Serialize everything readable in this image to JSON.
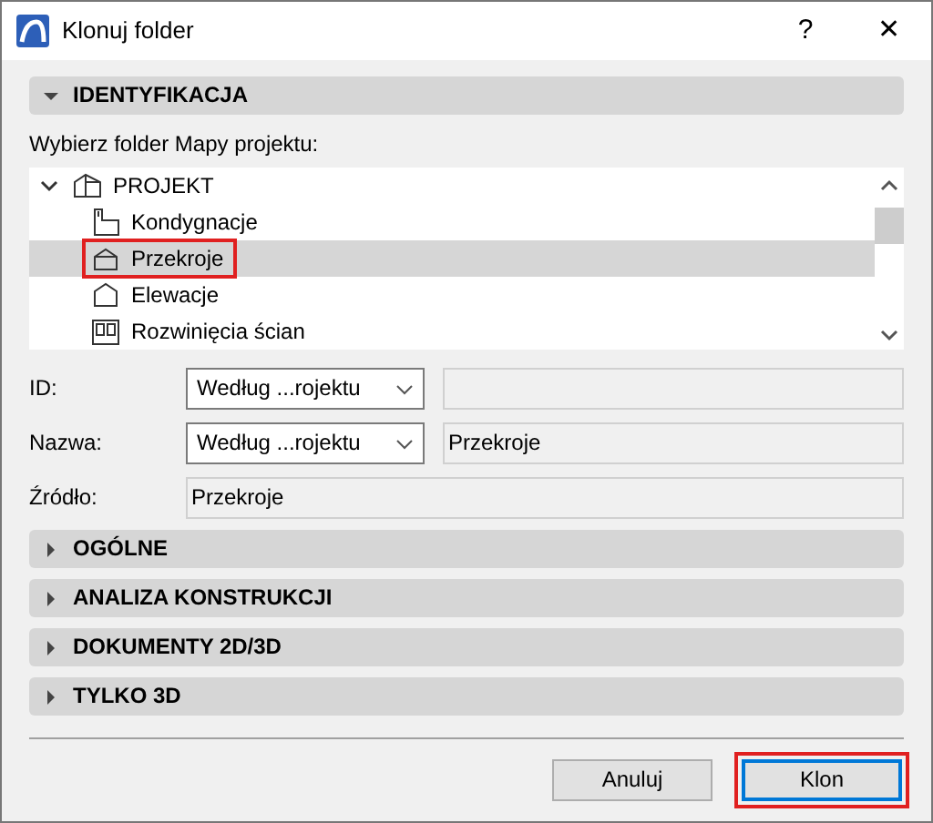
{
  "window": {
    "title": "Klonuj folder",
    "help": "?",
    "close": "✕"
  },
  "identification": {
    "title": "IDENTYFIKACJA",
    "expanded": true,
    "prompt": "Wybierz folder Mapy projektu:",
    "tree": [
      {
        "label": "PROJEKT",
        "expanded": true,
        "selected": false,
        "highlighted": false,
        "children": [
          {
            "label": "Kondygnacje",
            "selected": false,
            "highlighted": false
          },
          {
            "label": "Przekroje",
            "selected": true,
            "highlighted": true
          },
          {
            "label": "Elewacje",
            "selected": false,
            "highlighted": false
          },
          {
            "label": "Rozwinięcia ścian",
            "selected": false,
            "highlighted": false
          }
        ]
      }
    ],
    "fields": [
      {
        "kind": "select",
        "label": "ID:",
        "option": "Według ...rojektu"
      },
      {
        "kind": "select",
        "label": "Nazwa:",
        "option": "Według ...rojektu",
        "value": "Przekroje"
      },
      {
        "kind": "text",
        "label": "Źródło:",
        "value": "Przekroje"
      }
    ]
  },
  "sections": [
    {
      "title": "OGÓLNE",
      "expanded": false
    },
    {
      "title": "ANALIZA KONSTRUKCJI",
      "expanded": false
    },
    {
      "title": "DOKUMENTY 2D/3D",
      "expanded": false
    },
    {
      "title": "TYLKO 3D",
      "expanded": false
    }
  ],
  "buttons": [
    {
      "label": "Anuluj",
      "default": false,
      "highlighted": false
    },
    {
      "label": "Klon",
      "default": true,
      "highlighted": true
    }
  ]
}
